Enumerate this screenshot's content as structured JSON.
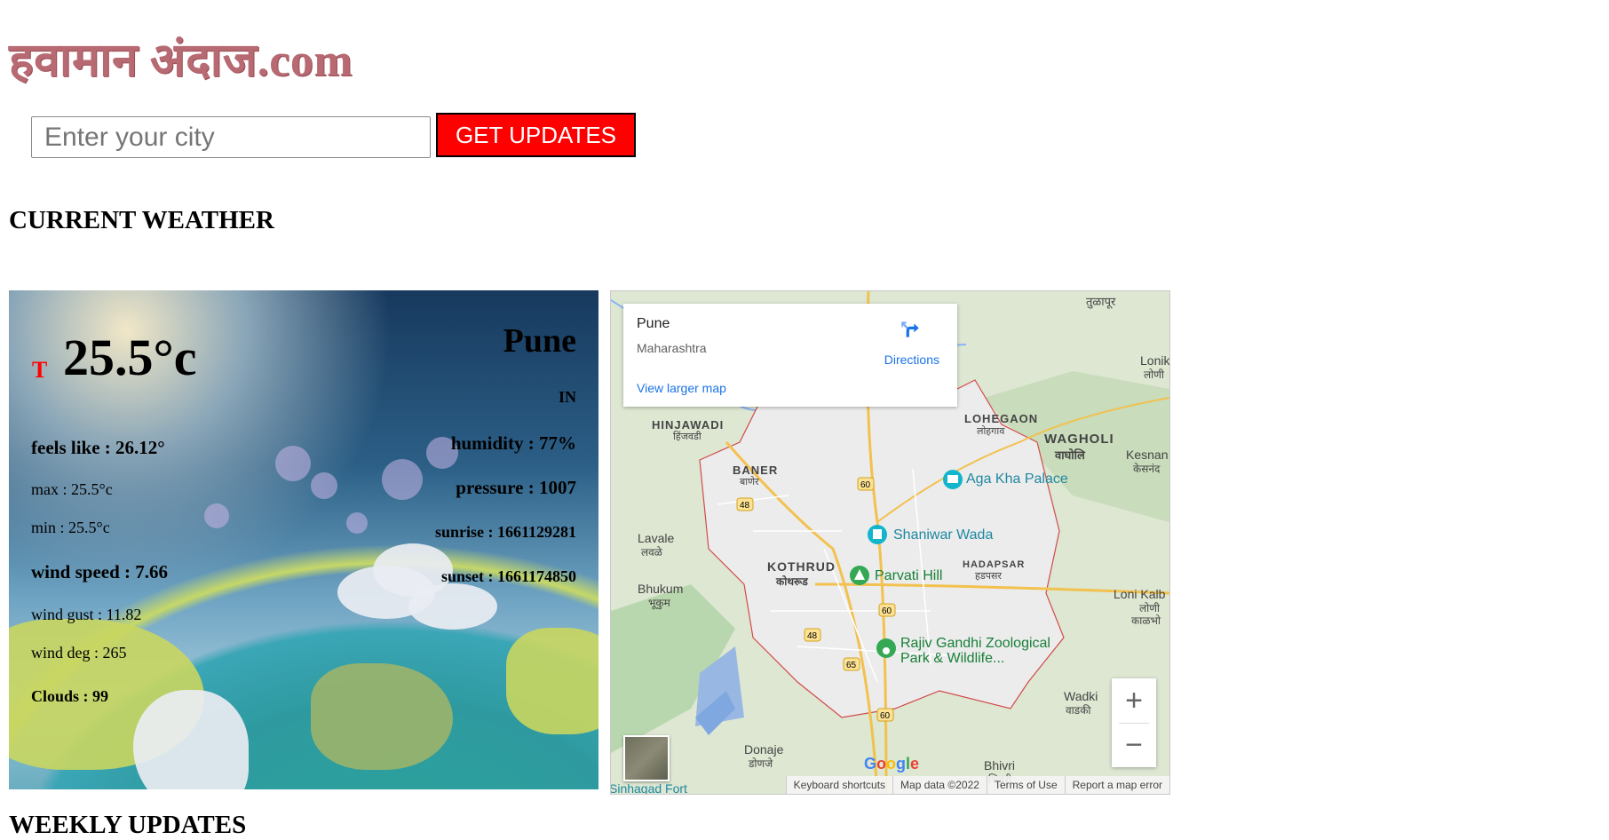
{
  "header": {
    "logo_text": "हवामान अंदाज.com"
  },
  "search": {
    "placeholder": "Enter your city",
    "button_label": "GET UPDATES"
  },
  "sections": {
    "current_weather": "CURRENT WEATHER",
    "weekly_updates": "WEEKLY UPDATES"
  },
  "weather": {
    "temp_marker": "T",
    "temperature": "25.5°c",
    "city": "Pune",
    "country": "IN",
    "feels_like": "feels like : 26.12°",
    "max": "max : 25.5°c",
    "min": "min : 25.5°c",
    "wind_speed": "wind speed : 7.66",
    "wind_gust": "wind gust : 11.82",
    "wind_deg": "wind deg : 265",
    "clouds": "Clouds : 99",
    "humidity": "humidity : 77%",
    "pressure": "pressure : 1007",
    "sunrise": "sunrise : 1661129281",
    "sunset": "sunset : 1661174850"
  },
  "map": {
    "place_title": "Pune",
    "place_subtitle": "Maharashtra",
    "directions_label": "Directions",
    "larger_map_label": "View larger map",
    "labels": {
      "hinjawadi": "HINJAWADI",
      "hinjawadi_mr": "हिंजवडी",
      "lohegaon": "LOHEGAON",
      "lohegaon_mr": "लोहगाव",
      "wagholi": "WAGHOLI",
      "wagholi_mr": "वाघोलि",
      "baner": "BANER",
      "baner_mr": "बाणेर",
      "kothrud": "KOTHRUD",
      "kothrud_mr": "कोथरूड",
      "hadapsar": "HADAPSAR",
      "hadapsar_mr": "हडपसर",
      "lavale": "Lavale",
      "lavale_mr": "लवळे",
      "bhukum": "Bhukum",
      "bhukum_mr": "भूकुम",
      "kesnand": "Kesnan",
      "kesnand_mr": "केसनंद",
      "lonikand": "Lonik",
      "lonikand_mr": "लोणी",
      "loni_kalbhor": "Loni Kalb",
      "loni_kalbhor_mr1": "लोणी",
      "loni_kalbhor_mr2": "काळभो",
      "tulapur": "तुळापूर",
      "wadki": "Wadki",
      "wadki_mr": "वाडकी",
      "donaje": "Donaje",
      "donaje_mr": "डोणजे",
      "bhivri": "Bhivri",
      "bhivri_mr": "भिवरी",
      "sinhagad": "Sinhagad Fort",
      "aga_khan": "Aga Kha Palace",
      "shaniwar": "Shaniwar Wada",
      "parvati": "Parvati Hill",
      "zoo1": "Rajiv Gandhi Zoological",
      "zoo2": "Park & Wildlife..."
    },
    "road_numbers": [
      "60",
      "48",
      "60",
      "48",
      "65",
      "60"
    ],
    "logo": "Google",
    "attribution": [
      "Keyboard shortcuts",
      "Map data ©2022",
      "Terms of Use",
      "Report a map error"
    ],
    "zoom_in": "+",
    "zoom_out": "−"
  }
}
